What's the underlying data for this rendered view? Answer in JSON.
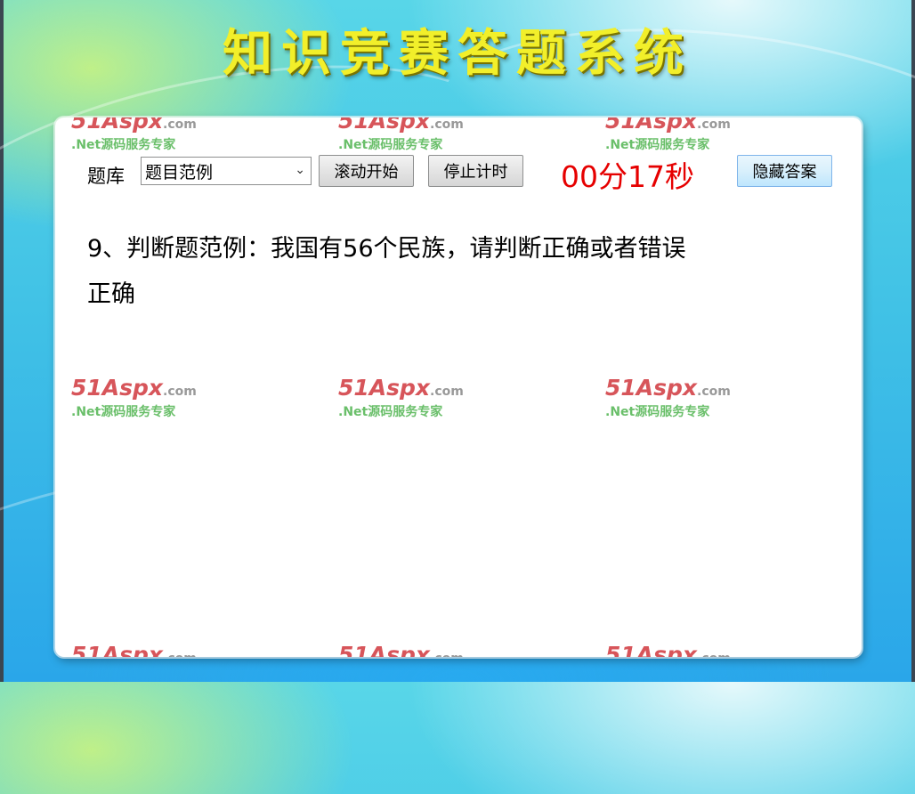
{
  "app": {
    "title": "知识竞赛答题系统"
  },
  "watermark": {
    "brand": "51Aspx",
    "domain": ".com",
    "tagline": ".Net源码服务专家"
  },
  "toolbar": {
    "bank_label": "题库",
    "bank_selected": "题目范例",
    "start_label": "滚动开始",
    "stop_label": "停止计时",
    "timer": "00分17秒",
    "hide_label": "隐藏答案"
  },
  "question": {
    "text": "9、判断题范例：我国有56个民族，请判断正确或者错误",
    "answer": "正确"
  },
  "colors": {
    "title": "#f2ef2a",
    "timer": "#e60000",
    "watermark_red": "#d7555a",
    "watermark_green": "#6abf6a"
  }
}
